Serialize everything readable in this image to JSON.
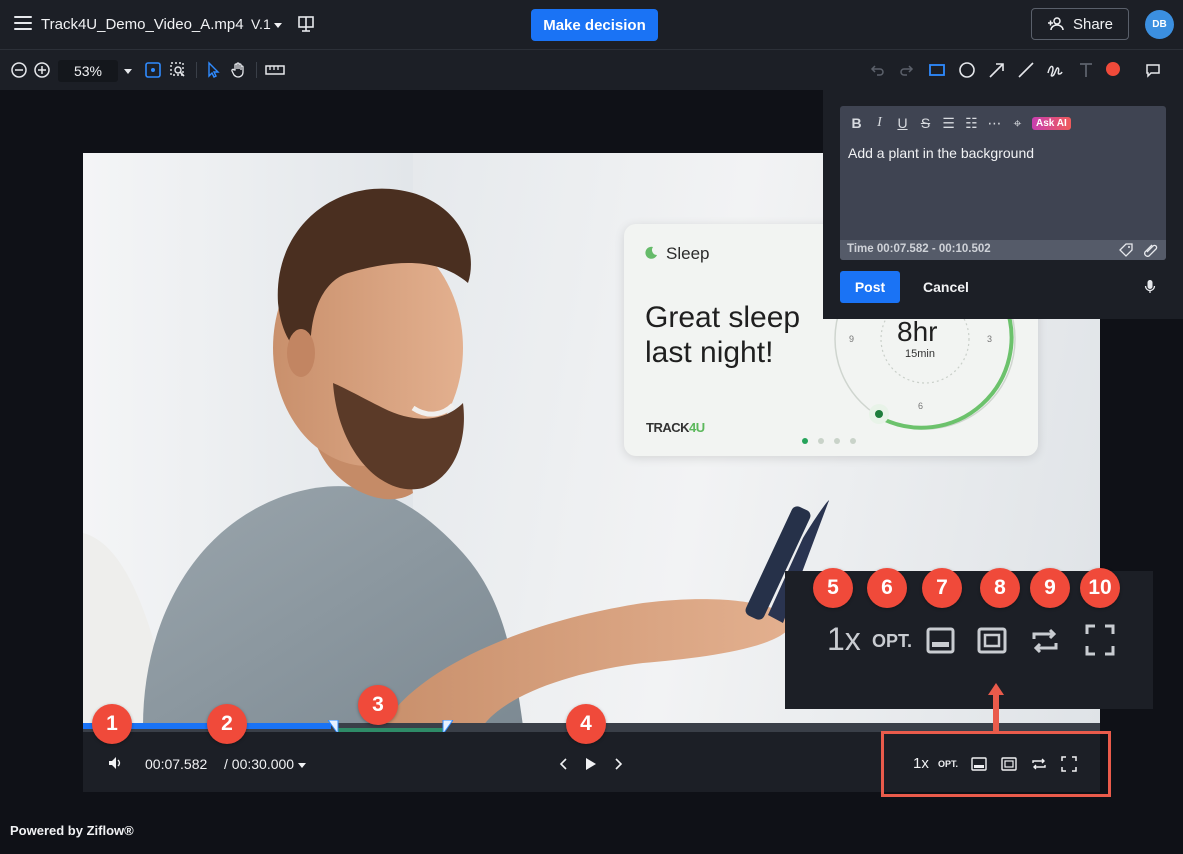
{
  "header": {
    "filename": "Track4U_Demo_Video_A.mp4",
    "version": "V.1",
    "decision_label": "Make decision",
    "share_label": "Share",
    "avatar_initials": "DB"
  },
  "toolbar": {
    "zoom_value": "53%",
    "annotation_color": "#f04a3a",
    "accent": "#1a73f5"
  },
  "video_content": {
    "card_title": "Sleep",
    "headline": "Great sleep last night!",
    "dial_hours": "8hr",
    "dial_minutes": "15min",
    "dial_numbers": [
      "9",
      "3",
      "6"
    ],
    "brand": "TRACK",
    "brand_accent": "4U"
  },
  "comment": {
    "format_tools": [
      "bold-icon",
      "italic-icon",
      "underline-icon",
      "strikethrough-icon",
      "bullet-list-icon",
      "numbered-list-icon",
      "more-icon",
      "pen-cursor-icon"
    ],
    "ask_ai_label": "Ask AI",
    "text": "Add a plant in the background",
    "time_range": "Time 00:07.582 - 00:10.502",
    "post_label": "Post",
    "cancel_label": "Cancel"
  },
  "player": {
    "current_time": "00:07.582",
    "duration": "/ 00:30.000",
    "speed_label": "1x",
    "quality_label": "OPT."
  },
  "annotations": {
    "badges": [
      "1",
      "2",
      "3",
      "4",
      "5",
      "6",
      "7",
      "8",
      "9",
      "10"
    ],
    "callout_speed": "1x",
    "callout_quality": "OPT."
  },
  "footer": {
    "powered_by": "Powered by Ziflow®"
  }
}
